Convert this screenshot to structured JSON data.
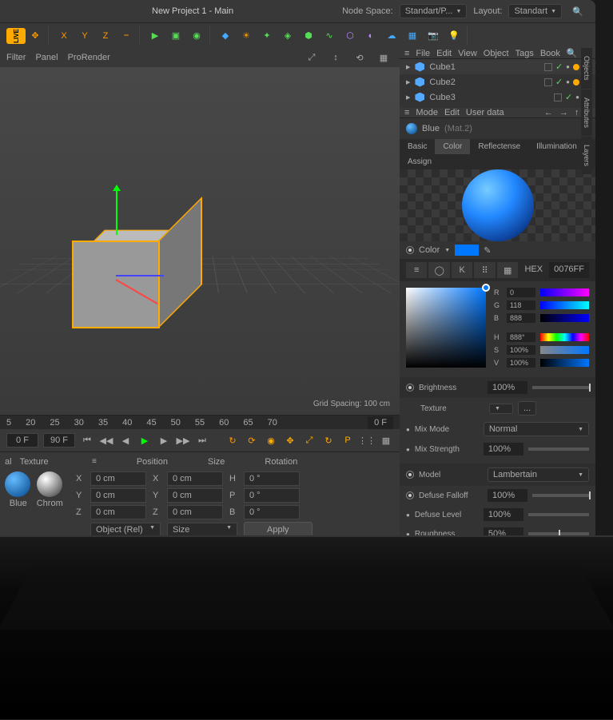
{
  "title": "New Project 1 - Main",
  "nodeSpace": {
    "label": "Node Space:",
    "value": "Standart/P..."
  },
  "layout": {
    "label": "Layout:",
    "value": "Standart"
  },
  "menu1": [
    "Filter",
    "Panel",
    "ProRender"
  ],
  "menu2": [
    "File",
    "Edit",
    "View",
    "Object",
    "Tags",
    "Book"
  ],
  "objects": [
    {
      "name": "Cube1",
      "selected": true,
      "green": true,
      "orange": true,
      "blue": true
    },
    {
      "name": "Cube2",
      "green": true,
      "orange": true,
      "blue": true
    },
    {
      "name": "Cube3",
      "green": true,
      "orange": true
    }
  ],
  "attrMenu": [
    "Mode",
    "Edit",
    "User data"
  ],
  "material": {
    "name": "Blue",
    "sub": "(Mat.2)"
  },
  "matTabs": [
    "Basic",
    "Color",
    "Reflectense",
    "Illumination",
    "Assign"
  ],
  "colorLabel": "Color",
  "hex": {
    "label": "HEX",
    "value": "0076FF"
  },
  "rgb": {
    "r": "0",
    "g": "118",
    "b": "888"
  },
  "hsv": {
    "h": "888°",
    "s": "100%",
    "v": "100%"
  },
  "brightness": {
    "label": "Brightness",
    "value": "100%"
  },
  "texture": {
    "label": "Texture",
    "menu": "..."
  },
  "mixMode": {
    "label": "Mix Mode",
    "value": "Normal"
  },
  "mixStrength": {
    "label": "Mix Strength",
    "value": "100%"
  },
  "model": {
    "label": "Model",
    "value": "Lambertain"
  },
  "defuseFalloff": {
    "label": "Defuse Falloff",
    "value": "100%"
  },
  "defuseLevel": {
    "label": "Defuse Level",
    "value": "100%"
  },
  "roughness": {
    "label": "Roughness",
    "value": "50%"
  },
  "gridSpacing": "Grid Spacing: 100 cm",
  "ruler": [
    "5",
    "20",
    "25",
    "30",
    "35",
    "40",
    "45",
    "50",
    "55",
    "60",
    "65",
    "70"
  ],
  "rulerEnd": "0 F",
  "timeline": {
    "start": "0 F",
    "end": "90 F"
  },
  "matPanelTabs": [
    "al",
    "Texture"
  ],
  "materials": [
    {
      "name": "Blue"
    },
    {
      "name": "Chrom"
    }
  ],
  "coords": {
    "headers": [
      "Position",
      "Size",
      "Rotation"
    ],
    "pos": {
      "x": "0 cm",
      "y": "0 cm",
      "z": "0 cm"
    },
    "size": {
      "x": "0 cm",
      "y": "0 cm",
      "z": "0 cm"
    },
    "rot": {
      "h": "0 °",
      "p": "0 °",
      "b": "0 °"
    },
    "objRel": "Object (Rel)",
    "sizeSel": "Size",
    "apply": "Apply"
  },
  "sideTabs": [
    "Objects",
    "Attributes",
    "Layers"
  ]
}
